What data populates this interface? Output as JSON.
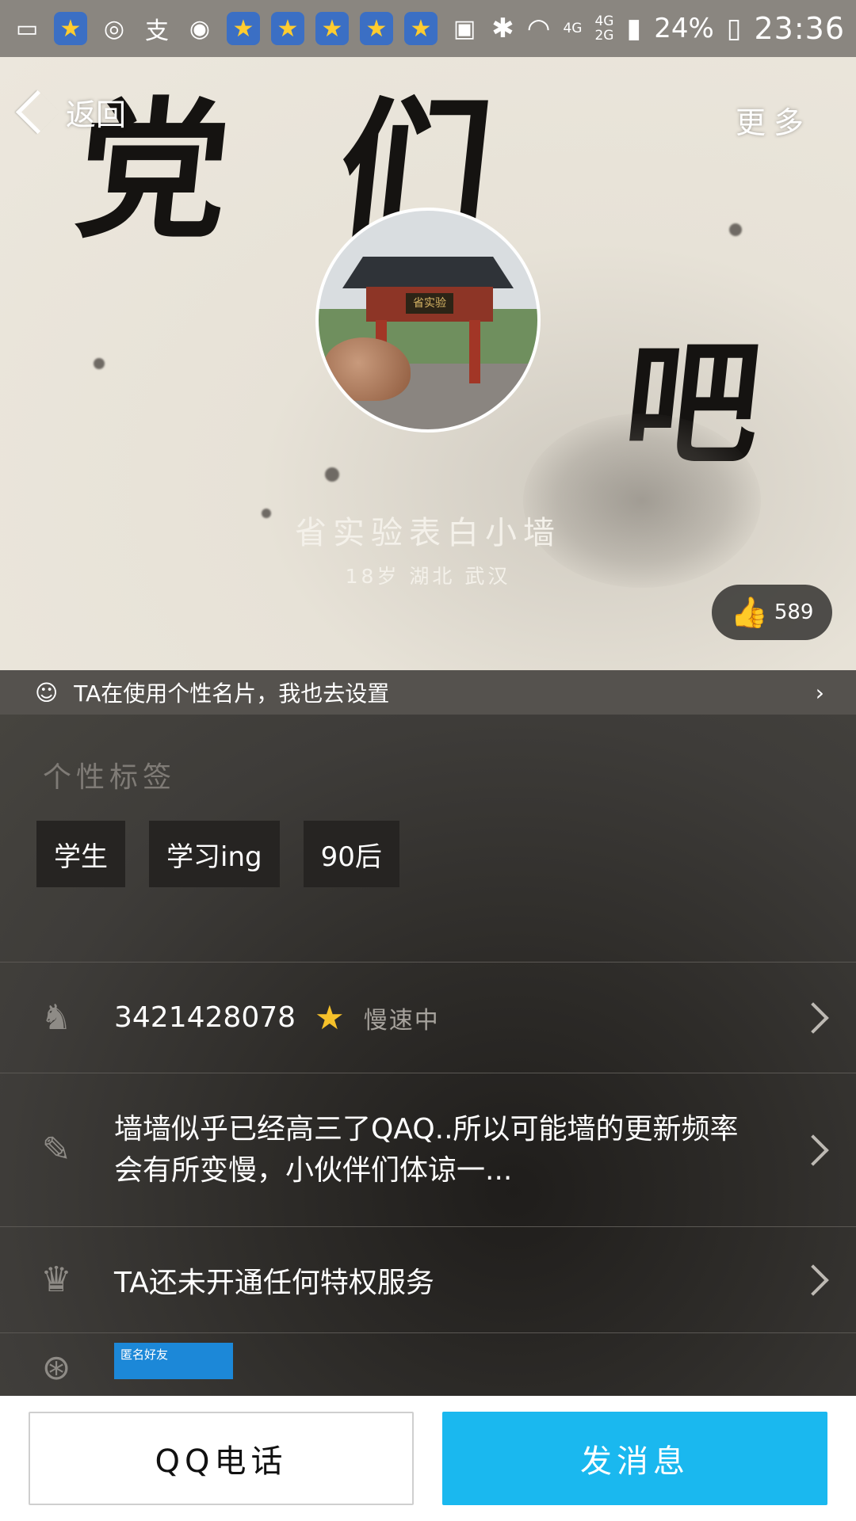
{
  "status_bar": {
    "network": "4G",
    "network_dual": "4G\n2G",
    "battery": "24%",
    "time": "23:36"
  },
  "cover": {
    "calligraphy_line1": "党们",
    "calligraphy_line2": "吧"
  },
  "nav": {
    "back_label": "返回",
    "more_label": "更多"
  },
  "avatar": {
    "plaque_text": "省实验"
  },
  "profile": {
    "name": "省实验表白小墙",
    "meta": "18岁 湖北 武汉",
    "likes": "589"
  },
  "card_strip": {
    "text": "TA在使用个性名片，我也去设置"
  },
  "tags": {
    "title": "个性标签",
    "items": [
      "学生",
      "学习ing",
      "90后"
    ]
  },
  "rows": {
    "qq_number": "3421428078",
    "qq_status": "慢速中",
    "signature": "墙墙似乎已经高三了QAQ..所以可能墙的更新频率会有所变慢，小伙伴们体谅一...",
    "privilege": "TA还未开通任何特权服务",
    "friend_thumb_text": "匿名好友"
  },
  "actions": {
    "call": "QQ电话",
    "message": "发消息"
  },
  "colors": {
    "accent": "#1ab8ef",
    "star": "#f6c12a"
  }
}
